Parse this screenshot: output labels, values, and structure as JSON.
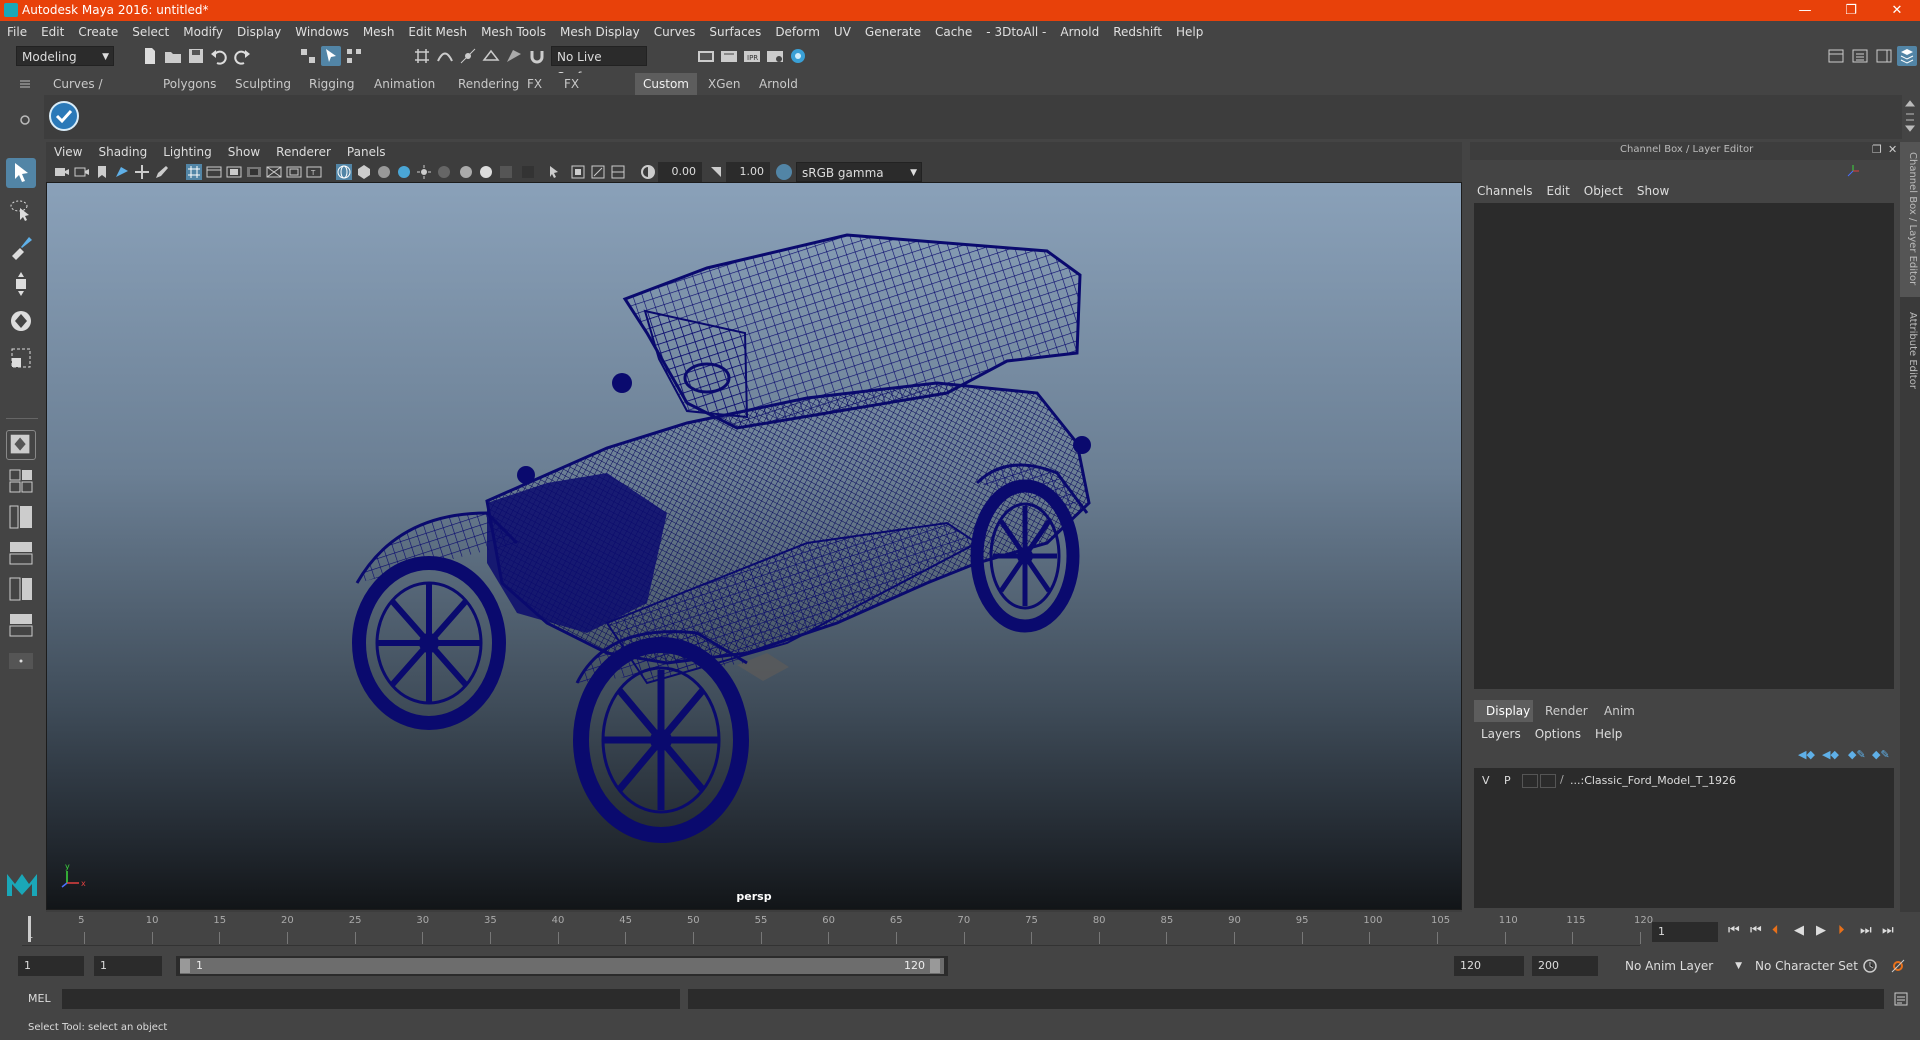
{
  "window": {
    "title": "Autodesk Maya 2016: untitled*",
    "controls": [
      "—",
      "❐",
      "✕"
    ]
  },
  "menubar": [
    "File",
    "Edit",
    "Create",
    "Select",
    "Modify",
    "Display",
    "Windows",
    "Mesh",
    "Edit Mesh",
    "Mesh Tools",
    "Mesh Display",
    "Curves",
    "Surfaces",
    "Deform",
    "UV",
    "Generate",
    "Cache",
    "- 3DtoAll -",
    "Arnold",
    "Redshift",
    "Help"
  ],
  "statusline": {
    "menuset": "Modeling",
    "live_surface": "No Live Surface"
  },
  "shelf": {
    "tabs": [
      "Curves / Surfaces",
      "Polygons",
      "Sculpting",
      "Rigging",
      "Animation",
      "Rendering",
      "FX",
      "FX Caching",
      "Custom",
      "XGen",
      "Arnold"
    ],
    "active_tab": "Custom"
  },
  "viewport": {
    "menu": [
      "View",
      "Shading",
      "Lighting",
      "Show",
      "Renderer",
      "Panels"
    ],
    "exposure": "0.00",
    "gamma": "1.00",
    "color_space": "sRGB gamma",
    "camera": "persp"
  },
  "channel_box": {
    "title": "Channel Box / Layer Editor",
    "menu": [
      "Channels",
      "Edit",
      "Object",
      "Show"
    ]
  },
  "layer_editor": {
    "tabs": [
      "Display",
      "Render",
      "Anim"
    ],
    "active_tab": "Display",
    "menu": [
      "Layers",
      "Options",
      "Help"
    ],
    "layers": [
      {
        "v": "V",
        "p": "P",
        "name": "...:Classic_Ford_Model_T_1926"
      }
    ]
  },
  "side_tabs": [
    "Channel Box / Layer Editor",
    "Attribute Editor"
  ],
  "timeline": {
    "ticks": [
      "5",
      "10",
      "15",
      "20",
      "25",
      "30",
      "35",
      "40",
      "45",
      "50",
      "55",
      "60",
      "65",
      "70",
      "75",
      "80",
      "85",
      "90",
      "95",
      "100",
      "105",
      "110",
      "115",
      "120"
    ],
    "start_marker": "1",
    "current_frame": "1"
  },
  "range": {
    "start": "1",
    "playback_start": "1",
    "slider_start": "1",
    "slider_end": "120",
    "playback_end": "120",
    "end": "200",
    "anim_layer": "No Anim Layer",
    "character_set": "No Character Set"
  },
  "commandline": {
    "label": "MEL"
  },
  "helpline": {
    "text": "Select Tool: select an object"
  },
  "colors": {
    "titlebar": "#e8410a",
    "wireframe": "#0a0a6e",
    "active_tab": "#5d5d5d"
  }
}
